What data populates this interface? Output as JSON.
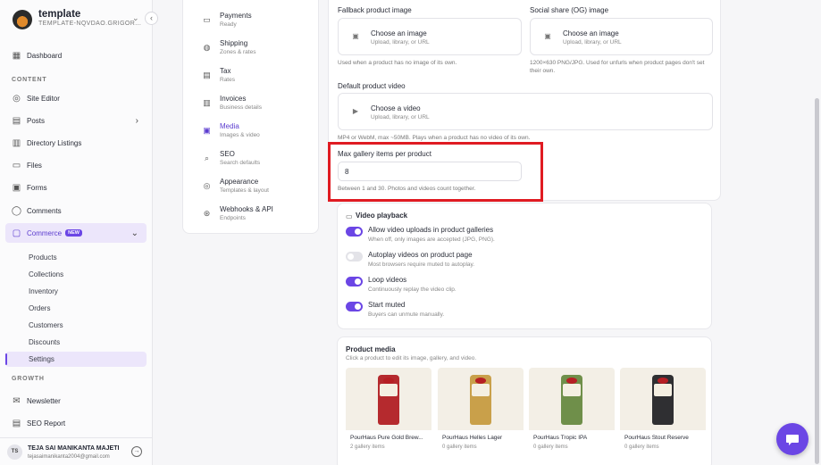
{
  "brand": {
    "name": "template",
    "subtitle": "TEMPLATE-NQVDAO.GRIGOR..."
  },
  "sidebar": {
    "dashboard": "Dashboard",
    "content_label": "CONTENT",
    "site_editor": "Site Editor",
    "posts": "Posts",
    "directory": "Directory Listings",
    "files": "Files",
    "forms": "Forms",
    "comments": "Comments",
    "commerce": "Commerce",
    "commerce_badge": "NEW",
    "sub": {
      "products": "Products",
      "collections": "Collections",
      "inventory": "Inventory",
      "orders": "Orders",
      "customers": "Customers",
      "discounts": "Discounts",
      "settings": "Settings"
    },
    "growth_label": "GROWTH",
    "newsletter": "Newsletter",
    "seo_report": "SEO Report"
  },
  "user": {
    "initials": "TS",
    "name": "TEJA SAI MANIKANTA MAJETI",
    "email": "tejasaimanikanta2004@gmail.com"
  },
  "subnav": [
    {
      "title": "Payments",
      "sub": "Ready"
    },
    {
      "title": "Shipping",
      "sub": "Zones & rates"
    },
    {
      "title": "Tax",
      "sub": "Rates"
    },
    {
      "title": "Invoices",
      "sub": "Business details"
    },
    {
      "title": "Media",
      "sub": "Images & video"
    },
    {
      "title": "SEO",
      "sub": "Search defaults"
    },
    {
      "title": "Appearance",
      "sub": "Templates & layout"
    },
    {
      "title": "Webhooks & API",
      "sub": "Endpoints"
    }
  ],
  "media": {
    "fallback_label": "Fallback product image",
    "fallback_title": "Choose an image",
    "fallback_sub": "Upload, library, or URL",
    "fallback_help": "Used when a product has no image of its own.",
    "og_label": "Social share (OG) image",
    "og_title": "Choose an image",
    "og_sub": "Upload, library, or URL",
    "og_help": "1200×630 PNG/JPG. Used for unfurls when product pages don't set their own.",
    "video_label": "Default product video",
    "video_title": "Choose a video",
    "video_sub": "Upload, library, or URL",
    "video_help": "MP4 or WebM, max ~50MB. Plays when a product has no video of its own.",
    "gallery_label": "Max gallery items per product",
    "gallery_value": "8",
    "gallery_help": "Between 1 and 30. Photos and videos count together."
  },
  "playback": {
    "title": "Video playback",
    "toggles": [
      {
        "label": "Allow video uploads in product galleries",
        "sub": "When off, only images are accepted (JPG, PNG).",
        "on": true
      },
      {
        "label": "Autoplay videos on product page",
        "sub": "Most browsers require muted to autoplay.",
        "on": false
      },
      {
        "label": "Loop videos",
        "sub": "Continuously replay the video clip.",
        "on": true
      },
      {
        "label": "Start muted",
        "sub": "Buyers can unmute manually.",
        "on": true
      }
    ]
  },
  "product_media": {
    "title": "Product media",
    "sub": "Click a product to edit its image, gallery, and video.",
    "products": [
      {
        "name": "PourHaus Pure Gold Brew...",
        "count": "2 gallery items",
        "color": "#b52a2e",
        "brand": "PourHaus"
      },
      {
        "name": "PourHaus Helles Lager",
        "count": "0 gallery items",
        "color": "#c9a04a",
        "brand": "PourHaus"
      },
      {
        "name": "PourHaus Tropic IPA",
        "count": "0 gallery items",
        "color": "#6f8f4a",
        "brand": "PourHaus"
      },
      {
        "name": "PourHaus Stout Reserve",
        "count": "0 gallery items",
        "color": "#2f2f32",
        "brand": "PourHaus"
      }
    ]
  },
  "colors": {
    "accent": "#6b46e5",
    "highlight": "#e01b22"
  }
}
